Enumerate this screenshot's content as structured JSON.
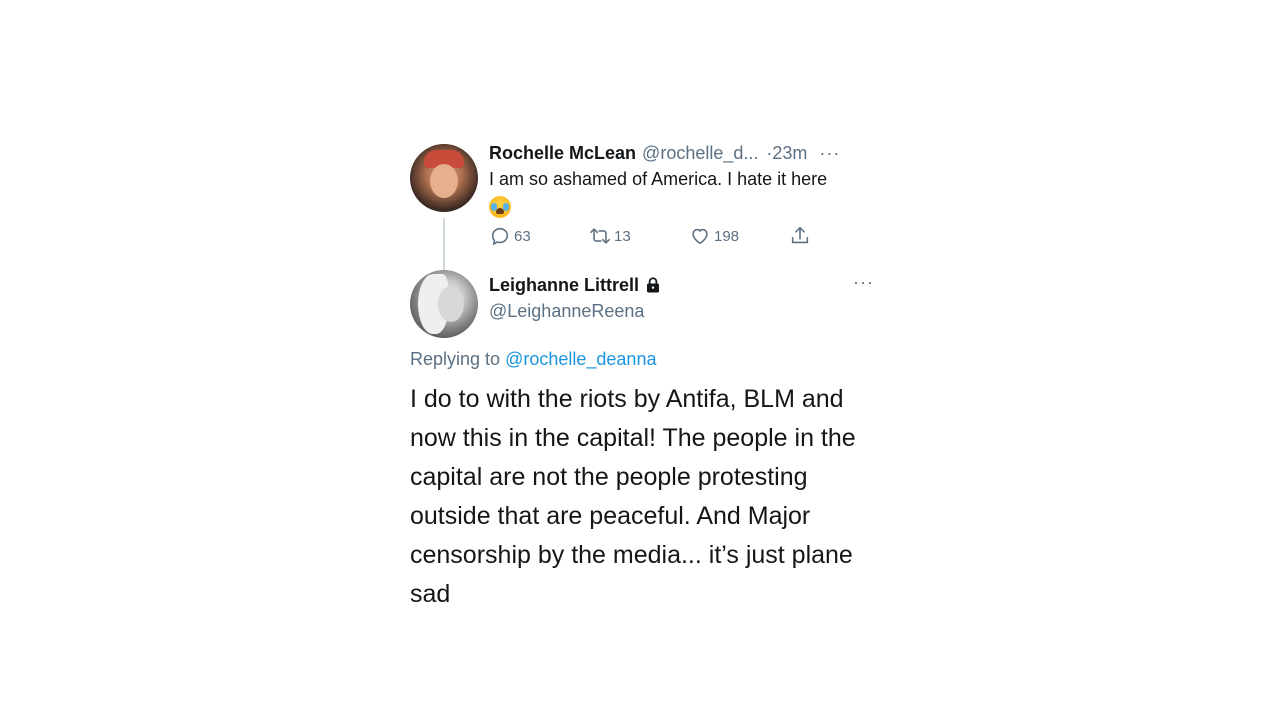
{
  "tweet1": {
    "name": "Rochelle McLean",
    "handle": "@rochelle_d...",
    "time": "·23m",
    "more": "···",
    "text": "I am so ashamed of America. I hate it here",
    "emoji": "loudly-crying-face",
    "replies": "63",
    "retweets": "13",
    "likes": "198"
  },
  "tweet2": {
    "name": "Leighanne Littrell",
    "handle": "@LeighanneReena",
    "more": "···",
    "replying_prefix": "Replying to",
    "replying_to": "@rochelle_deanna",
    "text": "I do to with the riots by Antifa, BLM and now this in the capital! The people in the capital are not the people protesting outside that are peaceful. And Major censorship by the media... it’s just plane sad"
  },
  "colors": {
    "text": "#14171a",
    "secondary": "#5b7083",
    "link": "#1b95e0",
    "thread_line": "#cfd9de"
  }
}
